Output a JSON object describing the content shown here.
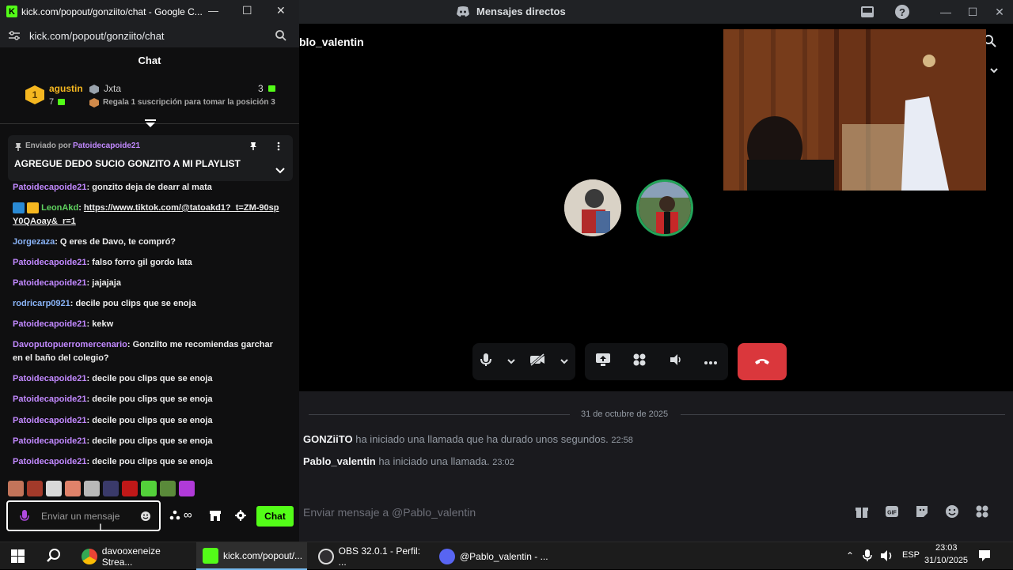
{
  "discord": {
    "window_title": "Mensajes directos",
    "call_username": "blo_valentin",
    "date_divider": "31 de octubre de 2025",
    "messages": [
      {
        "user": "GONZiiTO",
        "text": "ha iniciado una llamada que ha durado unos segundos.",
        "time": "22:58"
      },
      {
        "user": "Pablo_valentin",
        "text": "ha iniciado una llamada.",
        "time": "23:02"
      }
    ],
    "input_placeholder": "Enviar mensaje a @Pablo_valentin",
    "colors": {
      "hangup": "#da373c",
      "accent": "#5865f2",
      "avatar_ring": "#23a55a"
    },
    "icons": [
      "inbox-icon",
      "help-icon",
      "search-icon",
      "chevron-down-icon",
      "mic-icon",
      "camera-off-icon",
      "screen-share-icon",
      "activities-icon",
      "soundboard-icon",
      "more-icon",
      "hangup-icon",
      "gift-icon",
      "gif-icon",
      "sticker-icon",
      "emoji-icon",
      "apps-icon"
    ]
  },
  "kick": {
    "window_title": "kick.com/popout/gonziito/chat - Google C...",
    "url": "kick.com/popout/gonziito/chat",
    "header": "Chat",
    "leaderboard": {
      "rank": "1",
      "user1": "agustin",
      "user1_count": "7",
      "user2": "Jxta",
      "user2_count": "3",
      "promo": "Regala 1 suscripción para tomar la posición 3"
    },
    "pinned": {
      "by_label": "Enviado por",
      "by_user": "Patoidecapoide21",
      "text": "AGREGUE DEDO SUCIO GONZITO A MI PLAYLIST"
    },
    "messages": [
      {
        "user": "Patoidecapoide21",
        "text": ": gonzito deja de dearr al mata",
        "color": "#c289ff"
      },
      {
        "user": "LeonAkd",
        "text": ": ",
        "link": "https://www.tiktok.com/@tatoakd1?_t=ZM-90spY0QAoay&_r=1",
        "color": "#5fd35f"
      },
      {
        "user": "Jorgezaza",
        "text": ": Q eres de Davo, te compró?",
        "color": "#8ab4f8"
      },
      {
        "user": "Patoidecapoide21",
        "text": ": falso forro gil gordo lata",
        "color": "#c289ff"
      },
      {
        "user": "Patoidecapoide21",
        "text": ": jajajaja",
        "color": "#c289ff"
      },
      {
        "user": "rodricarp0921",
        "text": ": decile pou clips que se enoja",
        "color": "#8ab4f8"
      },
      {
        "user": "Patoidecapoide21",
        "text": ": kekw",
        "color": "#c289ff"
      },
      {
        "user": "Davoputopuerromercenario",
        "text": ": Gonzilto me recomiendas garchar en el baño del colegio?",
        "color": "#c289ff"
      },
      {
        "user": "Patoidecapoide21",
        "text": ": decile pou clips que se enoja",
        "color": "#c289ff"
      },
      {
        "user": "Patoidecapoide21",
        "text": ": decile pou clips que se enoja",
        "color": "#c289ff"
      },
      {
        "user": "Patoidecapoide21",
        "text": ": decile pou clips que se enoja",
        "color": "#c289ff"
      },
      {
        "user": "Patoidecapoide21",
        "text": ": decile pou clips que se enoja",
        "color": "#c289ff"
      },
      {
        "user": "Patoidecapoide21",
        "text": ": decile pou clips que se enoja",
        "color": "#c289ff"
      }
    ],
    "input_placeholder": "Enviar un mensaje",
    "chat_button": "Chat",
    "colors": {
      "brand": "#53fc18"
    }
  },
  "taskbar": {
    "apps": [
      {
        "label": "davooxeneize Strea..."
      },
      {
        "label": "kick.com/popout/..."
      },
      {
        "label": "OBS 32.0.1 - Perfil: ..."
      },
      {
        "label": "@Pablo_valentin - ..."
      }
    ],
    "lang": "ESP",
    "time": "23:03",
    "date": "31/10/2025"
  }
}
